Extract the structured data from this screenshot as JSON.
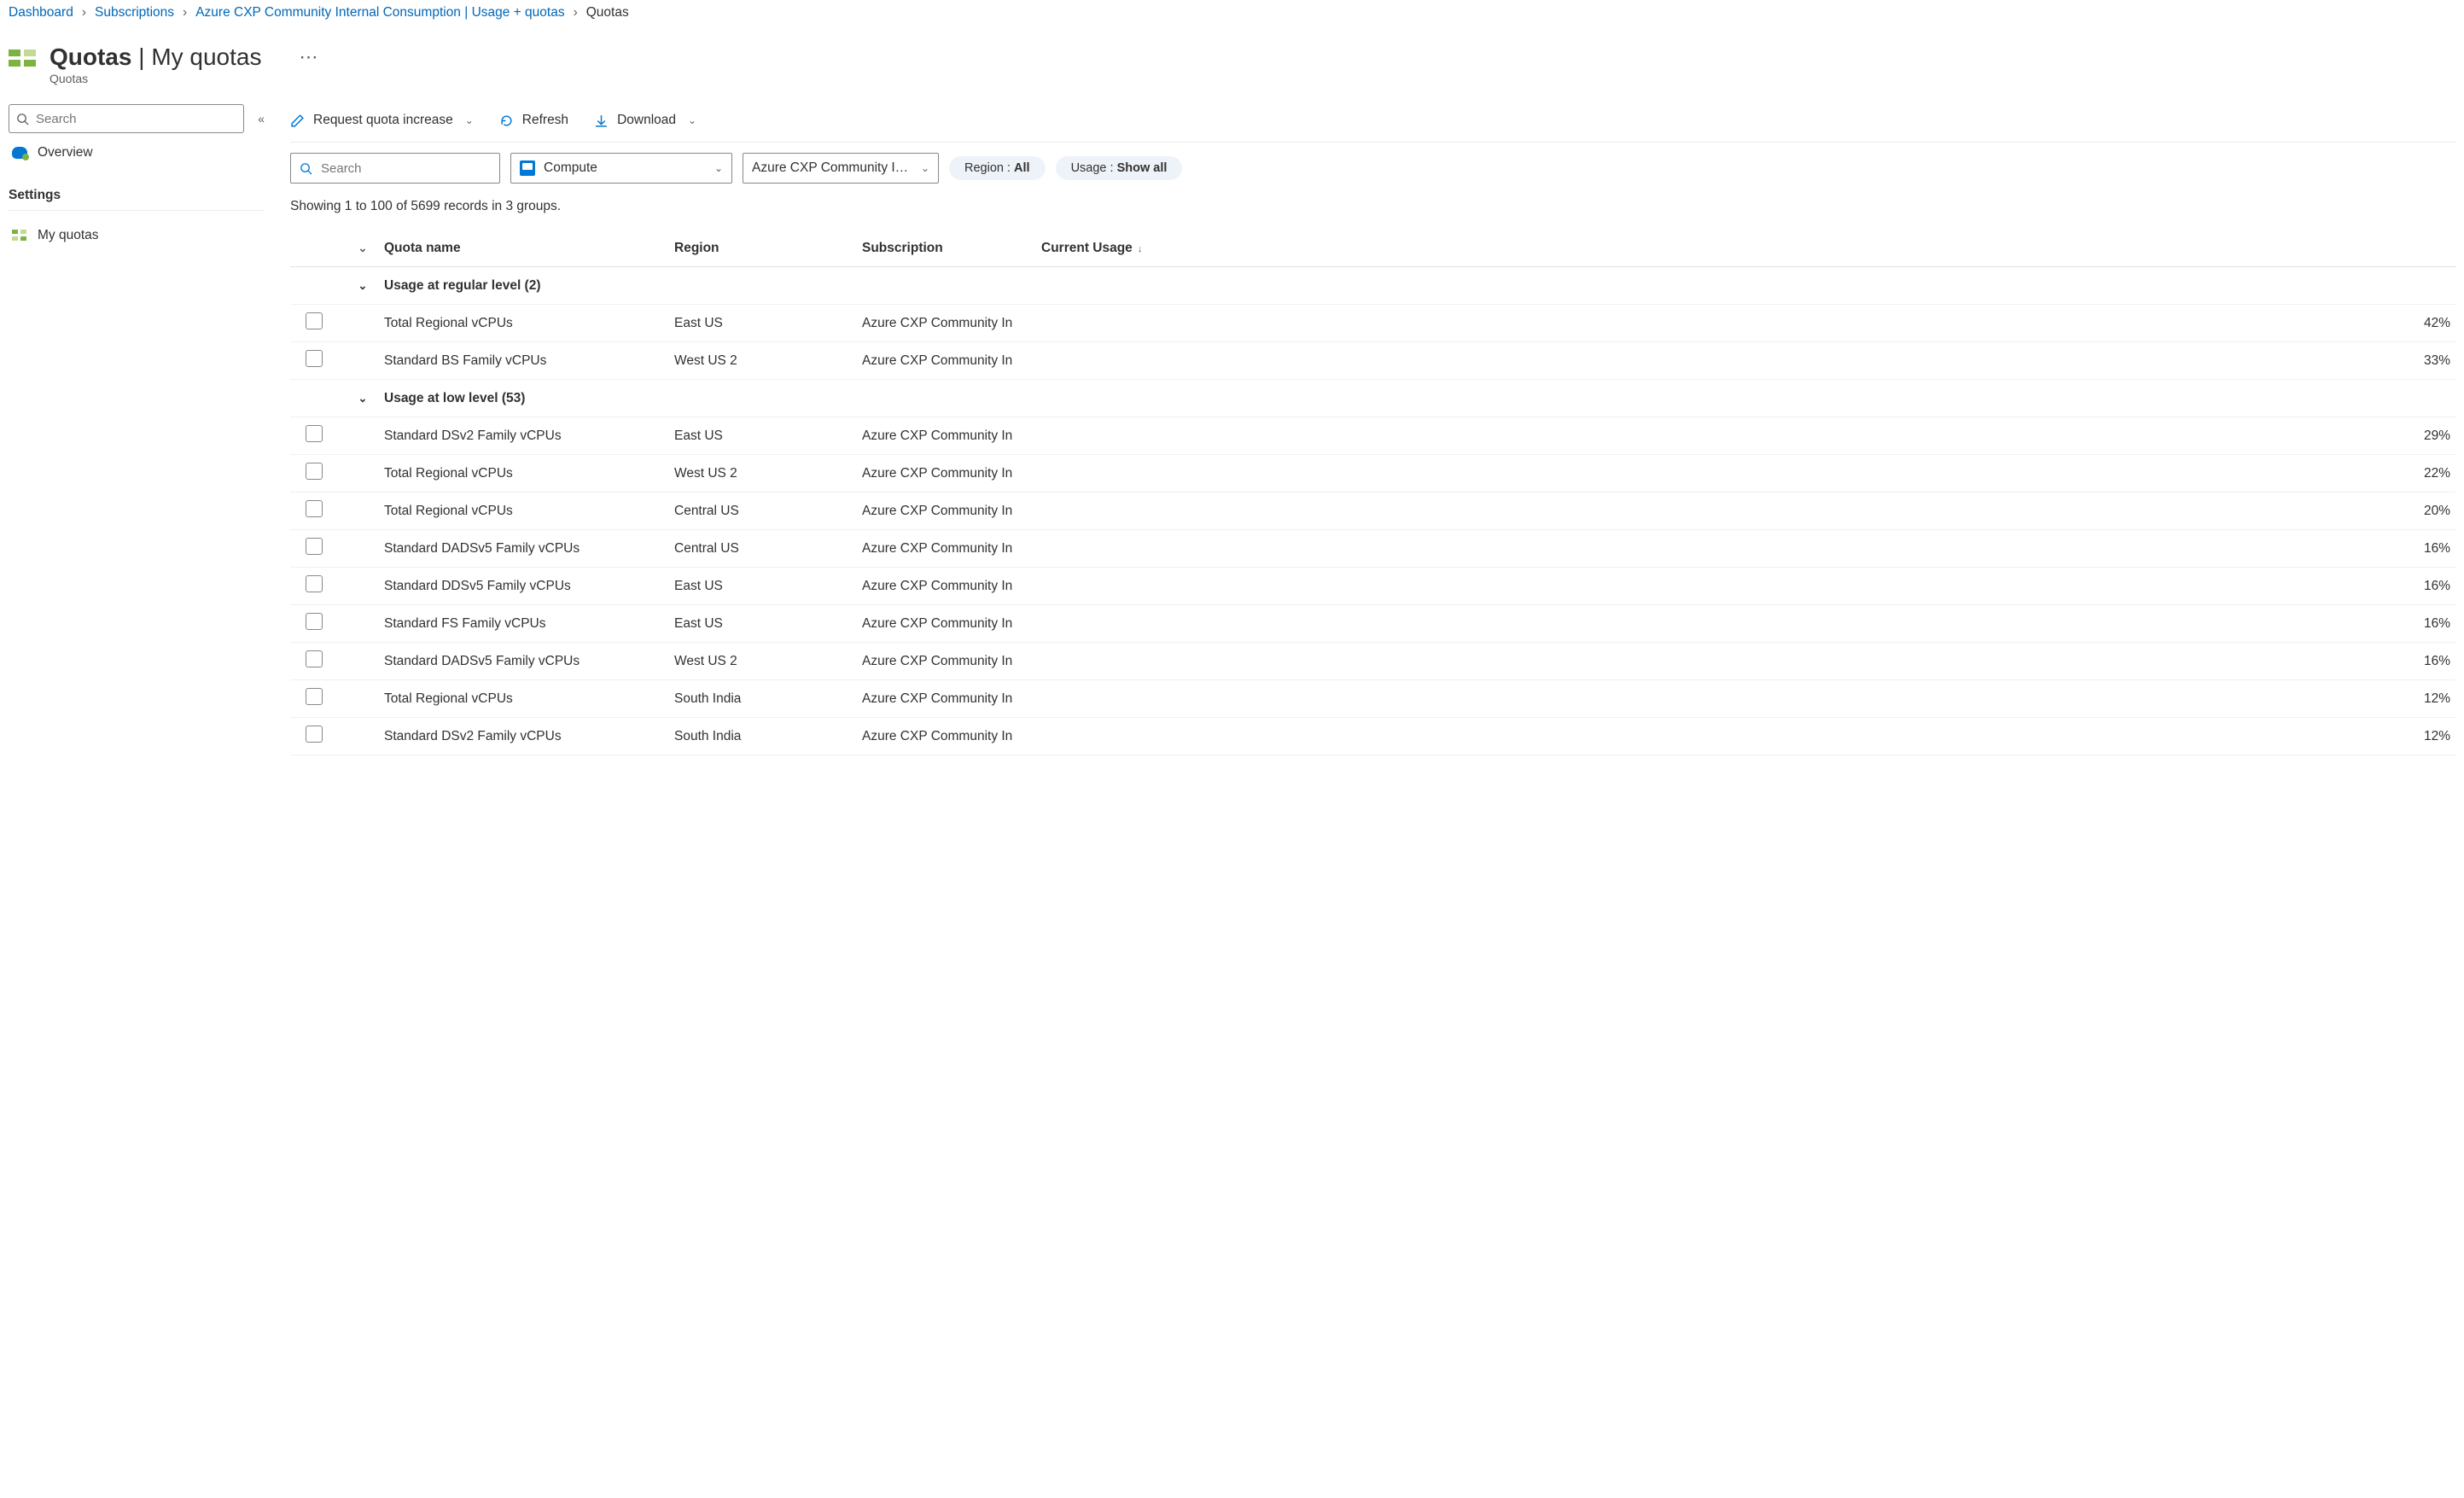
{
  "breadcrumb": {
    "items": [
      "Dashboard",
      "Subscriptions",
      "Azure CXP Community Internal Consumption | Usage + quotas",
      "Quotas"
    ]
  },
  "header": {
    "title_strong": "Quotas",
    "title_sep": " | ",
    "title_light": "My quotas",
    "subtitle": "Quotas"
  },
  "sidebar": {
    "search_placeholder": "Search",
    "overview": "Overview",
    "settings_label": "Settings",
    "my_quotas": "My quotas"
  },
  "cmd": {
    "request": "Request quota increase",
    "refresh": "Refresh",
    "download": "Download"
  },
  "filters": {
    "search_placeholder": "Search",
    "provider": "Compute",
    "subscription": "Azure CXP Community I…",
    "region_label": "Region : ",
    "region_value": "All",
    "usage_label": "Usage : ",
    "usage_value": "Show all"
  },
  "status_line": "Showing 1 to 100 of 5699 records in 3 groups.",
  "columns": {
    "quota": "Quota name",
    "region": "Region",
    "subscription": "Subscription",
    "usage": "Current Usage"
  },
  "groups": [
    {
      "title": "Usage at regular level (2)",
      "bar_class": "bar-green",
      "rows": [
        {
          "name": "Total Regional vCPUs",
          "region": "East US",
          "sub": "Azure CXP Community In",
          "pct": 42
        },
        {
          "name": "Standard BS Family vCPUs",
          "region": "West US 2",
          "sub": "Azure CXP Community In",
          "pct": 33
        }
      ]
    },
    {
      "title": "Usage at low level (53)",
      "bar_class": "bar-blue",
      "rows": [
        {
          "name": "Standard DSv2 Family vCPUs",
          "region": "East US",
          "sub": "Azure CXP Community In",
          "pct": 29
        },
        {
          "name": "Total Regional vCPUs",
          "region": "West US 2",
          "sub": "Azure CXP Community In",
          "pct": 22
        },
        {
          "name": "Total Regional vCPUs",
          "region": "Central US",
          "sub": "Azure CXP Community In",
          "pct": 20
        },
        {
          "name": "Standard DADSv5 Family vCPUs",
          "region": "Central US",
          "sub": "Azure CXP Community In",
          "pct": 16
        },
        {
          "name": "Standard DDSv5 Family vCPUs",
          "region": "East US",
          "sub": "Azure CXP Community In",
          "pct": 16
        },
        {
          "name": "Standard FS Family vCPUs",
          "region": "East US",
          "sub": "Azure CXP Community In",
          "pct": 16
        },
        {
          "name": "Standard DADSv5 Family vCPUs",
          "region": "West US 2",
          "sub": "Azure CXP Community In",
          "pct": 16
        },
        {
          "name": "Total Regional vCPUs",
          "region": "South India",
          "sub": "Azure CXP Community In",
          "pct": 12
        },
        {
          "name": "Standard DSv2 Family vCPUs",
          "region": "South India",
          "sub": "Azure CXP Community In",
          "pct": 12
        }
      ]
    }
  ]
}
